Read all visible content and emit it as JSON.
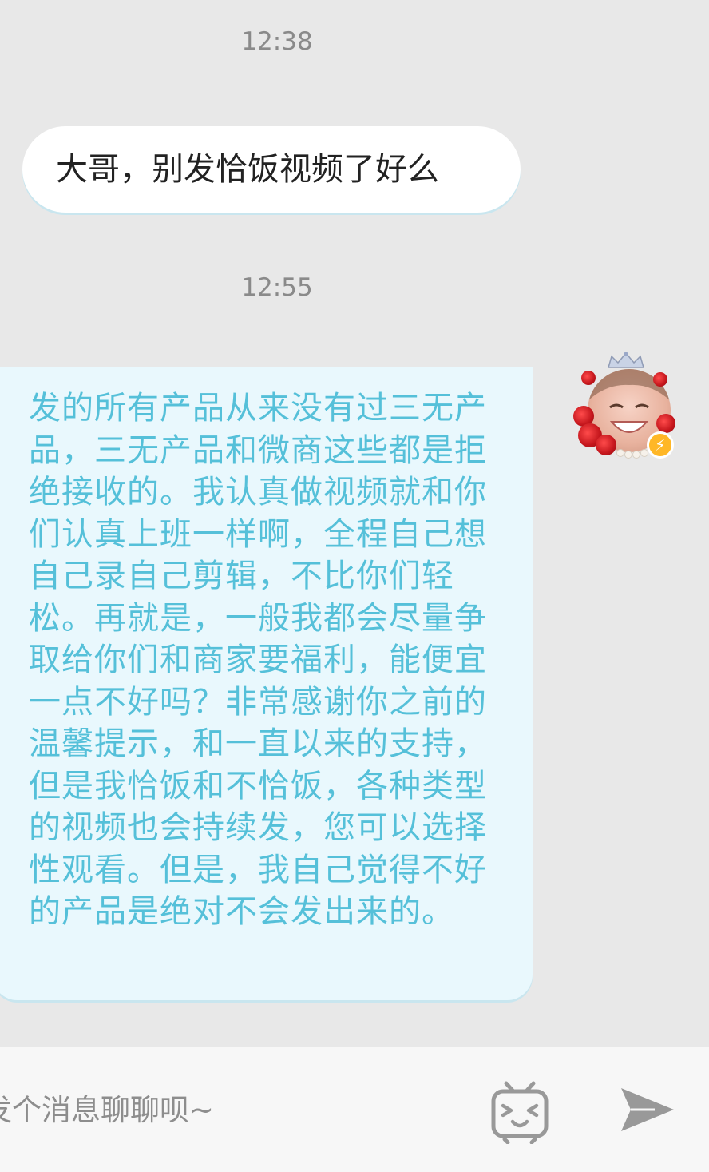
{
  "chat": {
    "messages": [
      {
        "time": "12:38",
        "direction": "incoming",
        "text": "大哥，别发恰饭视频了好么"
      },
      {
        "time": "12:55",
        "direction": "outgoing",
        "text": "发的所有产品从来没有过三无产品，三无产品和微商这些都是拒绝接收的。我认真做视频就和你们认真上班一样啊，全程自己想自己录自己剪辑，不比你们轻松。再就是，一般我都会尽量争取给你们和商家要福利，能便宜一点不好吗？非常感谢你之前的温馨提示，和一直以来的支持，但是我恰饭和不恰饭，各种类型的视频也会持续发，您可以选择性观看。但是，我自己觉得不好的产品是绝对不会发出来的。"
      }
    ],
    "avatar_icon": "user-avatar-with-rose-frame",
    "badge_icon": "lightning-badge-icon"
  },
  "input_bar": {
    "placeholder": "发个消息聊聊呗~",
    "emoji_icon": "tv-emoji-icon",
    "send_icon": "send-arrow-icon"
  },
  "colors": {
    "background": "#e8e8e8",
    "incoming_bubble": "#ffffff",
    "outgoing_bubble": "#e9f8fd",
    "outgoing_text": "#55c0d9",
    "timestamp_text": "#8a8a8a",
    "input_bar": "#f7f7f7",
    "icon_gray": "#999999"
  }
}
